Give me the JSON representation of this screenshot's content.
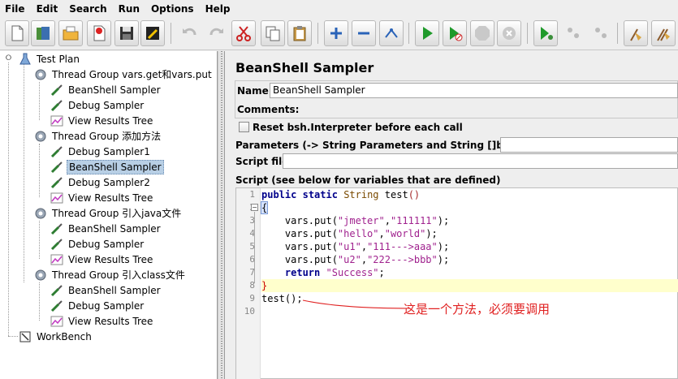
{
  "menu": [
    "File",
    "Edit",
    "Search",
    "Run",
    "Options",
    "Help"
  ],
  "toolbar": {
    "icons": [
      "new-icon",
      "templates-icon",
      "open-icon",
      "close-icon",
      "save-icon",
      "edit-icon",
      "undo-icon",
      "redo-icon",
      "cut-icon",
      "copy-icon",
      "paste-icon",
      "expand-icon",
      "collapse-icon",
      "toggle-icon",
      "start-icon",
      "start-no-pause-icon",
      "stop-icon",
      "shutdown-icon",
      "remote-start-icon",
      "remote-stop-icon",
      "remote-shutdown-icon",
      "clear-icon",
      "clear-all-icon"
    ]
  },
  "tree": {
    "test_plan": "Test Plan",
    "groups": [
      {
        "label": "Thread Group  vars.get和vars.put",
        "children": [
          "BeanShell Sampler",
          "Debug Sampler",
          "View Results Tree"
        ]
      },
      {
        "label": "Thread Group  添加方法",
        "children": [
          "Debug Sampler1",
          "BeanShell Sampler",
          "Debug Sampler2",
          "View Results Tree"
        ]
      },
      {
        "label": "Thread Group 引入java文件",
        "children": [
          "BeanShell Sampler",
          "Debug Sampler",
          "View Results Tree"
        ]
      },
      {
        "label": "Thread Group 引入class文件",
        "children": [
          "BeanShell Sampler",
          "Debug Sampler",
          "View Results Tree"
        ]
      }
    ],
    "workbench": "WorkBench"
  },
  "panel": {
    "title": "BeanShell Sampler",
    "name_label": "Name:",
    "name_value": "BeanShell Sampler",
    "comments_label": "Comments:",
    "reset_label": "Reset bsh.Interpreter before each call",
    "params_label": "Parameters (-> String Parameters and String []bsh.args)",
    "script_file_label": "Script file",
    "script_label": "Script (see below for variables that are defined)"
  },
  "code": {
    "line_numbers": [
      "1",
      "2",
      "3",
      "4",
      "5",
      "6",
      "7",
      "8",
      "9",
      "10"
    ],
    "line1": {
      "kw1": "public",
      "kw2": "static",
      "type": "String",
      "name": "test",
      "paren": "()"
    },
    "line2": {
      "brace": "{"
    },
    "line3": {
      "indent": "    vars.put(",
      "a": "\"jmeter\"",
      "comma": ",",
      "b": "\"111111\"",
      "end": ");"
    },
    "line4": {
      "indent": "    vars.put(",
      "a": "\"hello\"",
      "comma": ",",
      "b": "\"world\"",
      "end": ");"
    },
    "line5": {
      "indent": "    vars.put(",
      "a": "\"u1\"",
      "comma": ",",
      "b": "\"111--->aaa\"",
      "end": ");"
    },
    "line6": {
      "indent": "    vars.put(",
      "a": "\"u2\"",
      "comma": ",",
      "b": "\"222--->bbb\"",
      "end": ");"
    },
    "line7": {
      "indent": "    ",
      "kw": "return",
      "str": "\"Success\"",
      "end": ";"
    },
    "line8": {
      "brace": "}"
    },
    "line9": {
      "text": "test();"
    }
  },
  "annotation": "这是一个方法，必须要调用",
  "colors": {
    "annotation": "#e02020",
    "highlight_line": "#ffffcc",
    "selection": "#b8cfe5"
  }
}
